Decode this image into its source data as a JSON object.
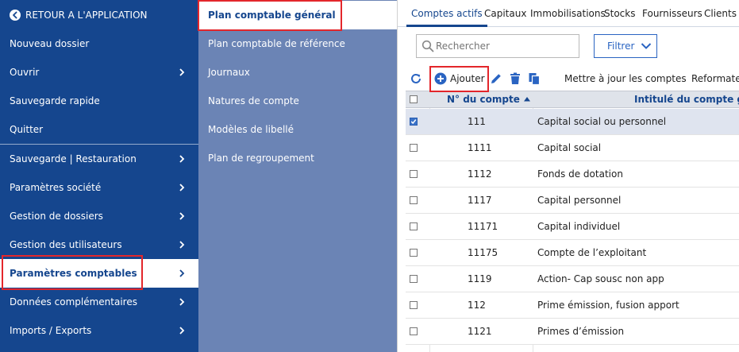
{
  "nav": {
    "back_label": "RETOUR A L'APPLICATION",
    "items": [
      {
        "label": "Nouveau dossier",
        "has_chevron": false
      },
      {
        "label": "Ouvrir",
        "has_chevron": true
      },
      {
        "label": "Sauvegarde rapide",
        "has_chevron": false
      },
      {
        "label": "Quitter",
        "has_chevron": false
      },
      {
        "label": "Sauvegarde | Restauration",
        "has_chevron": true
      },
      {
        "label": "Paramètres société",
        "has_chevron": true
      },
      {
        "label": "Gestion de dossiers",
        "has_chevron": true
      },
      {
        "label": "Gestion des utilisateurs",
        "has_chevron": true
      },
      {
        "label": "Paramètres comptables",
        "has_chevron": true,
        "active": true
      },
      {
        "label": "Données complémentaires",
        "has_chevron": true
      },
      {
        "label": "Imports / Exports",
        "has_chevron": true
      }
    ]
  },
  "submenu": {
    "items": [
      {
        "label": "Plan comptable général",
        "active": true
      },
      {
        "label": "Plan comptable de référence"
      },
      {
        "label": "Journaux"
      },
      {
        "label": "Natures de compte"
      },
      {
        "label": "Modèles de libellé"
      },
      {
        "label": "Plan de regroupement"
      }
    ]
  },
  "tabs": [
    "Comptes actifs",
    "Capitaux",
    "Immobilisations",
    "Stocks",
    "Fournisseurs",
    "Clients"
  ],
  "search": {
    "placeholder": "Rechercher",
    "value": ""
  },
  "filter": {
    "label": "Filtrer"
  },
  "toolbar": {
    "add_label": "Ajouter",
    "update_label": "Mettre à jour les comptes",
    "reformat_label": "Reformater"
  },
  "table": {
    "columns": [
      "N° du compte",
      "Intitulé du compte général"
    ],
    "sort_column": "N° du compte",
    "sort_direction": "ascending",
    "rows": [
      {
        "number": "111",
        "title": "Capital social ou personnel",
        "selected": true
      },
      {
        "number": "1111",
        "title": "Capital social",
        "selected": false
      },
      {
        "number": "1112",
        "title": "Fonds de dotation",
        "selected": false
      },
      {
        "number": "1117",
        "title": "Capital personnel",
        "selected": false
      },
      {
        "number": "11171",
        "title": "Capital individuel",
        "selected": false
      },
      {
        "number": "11175",
        "title": "Compte de l’exploitant",
        "selected": false
      },
      {
        "number": "1119",
        "title": "Action- Cap sousc non app",
        "selected": false
      },
      {
        "number": "112",
        "title": "Prime émission, fusion apport",
        "selected": false
      },
      {
        "number": "1121",
        "title": "Primes d’émission",
        "selected": false
      }
    ]
  },
  "colors": {
    "nav_bg": "#15468e",
    "submenu_bg": "#6b84b5",
    "accent": "#2a64c2",
    "highlight_box": "#e3262b",
    "selected_row": "#dfe4ef"
  }
}
